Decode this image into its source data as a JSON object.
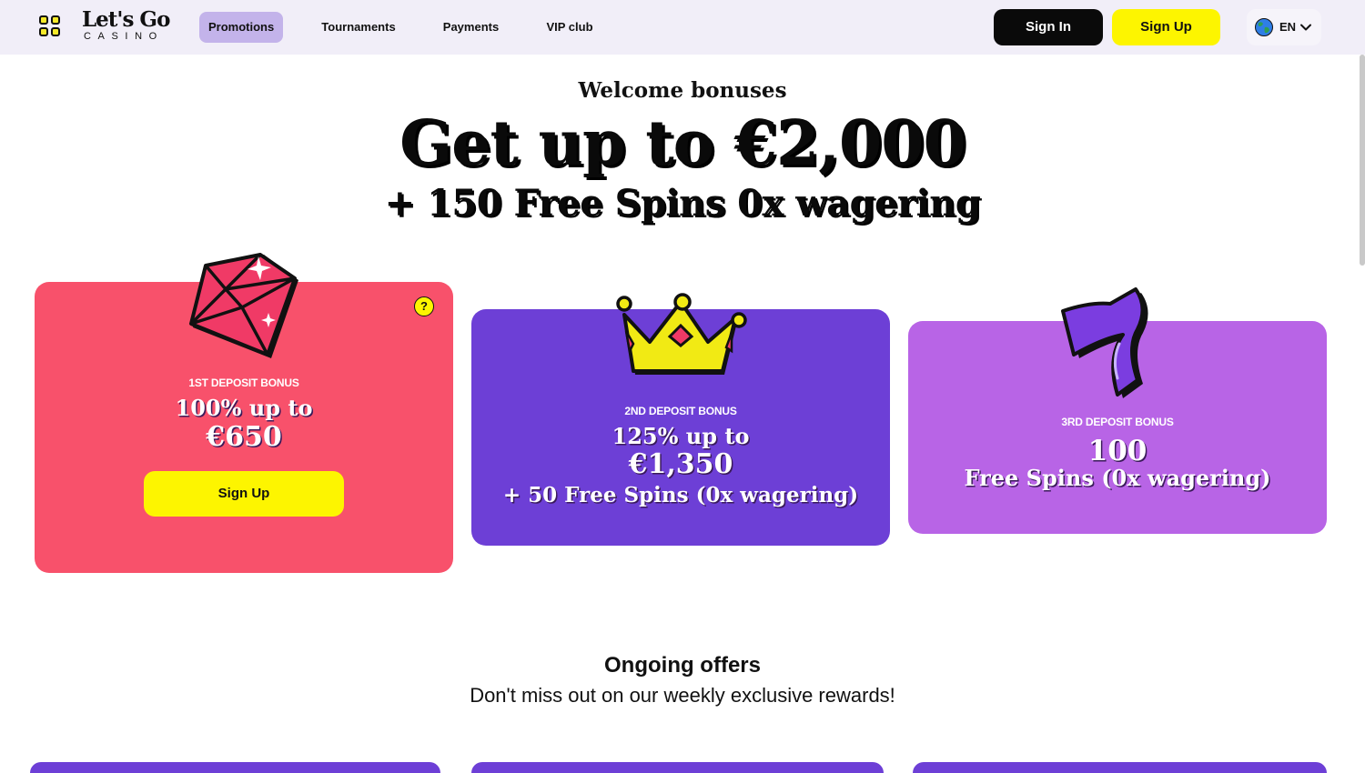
{
  "header": {
    "logo_main": "Let's Go",
    "logo_sub": "CASINO",
    "nav": [
      {
        "label": "Promotions"
      },
      {
        "label": "Tournaments"
      },
      {
        "label": "Payments"
      },
      {
        "label": "VIP club"
      }
    ],
    "sign_in": "Sign In",
    "sign_up": "Sign Up",
    "language": "EN"
  },
  "hero": {
    "eyebrow": "Welcome bonuses",
    "headline": "Get up to €2,000",
    "subheadline": "+ 150 Free Spins 0x wagering"
  },
  "bonuses": [
    {
      "label": "1st deposit bonus",
      "line1": "100% up to",
      "line2": "€650",
      "button": "Sign Up",
      "help": "?",
      "color": "#f8516b",
      "icon": "diamond-icon"
    },
    {
      "label": "2nd deposit bonus",
      "line1": "125% up to",
      "line2": "€1,350",
      "line3": "+ 50 Free Spins (0x wagering)",
      "color": "#6d3fd6",
      "icon": "crown-icon"
    },
    {
      "label": "3rd deposit bonus",
      "line1": "100",
      "line2": "Free Spins (0x wagering)",
      "color": "#b864e6",
      "icon": "lucky-seven-icon"
    }
  ],
  "ongoing": {
    "title": "Ongoing offers",
    "subtitle": "Don't miss out on our weekly exclusive rewards!"
  },
  "colors": {
    "accent_yellow": "#fdf500",
    "promo_active": "#c3b3ea",
    "header_bg": "#f1eef8"
  }
}
